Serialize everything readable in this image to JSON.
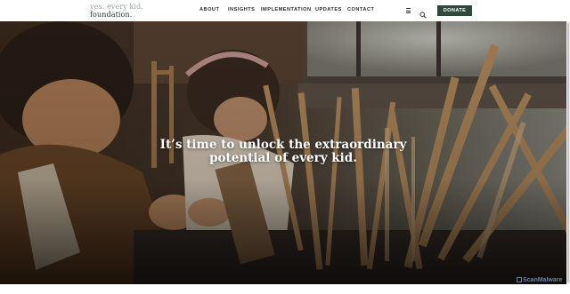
{
  "logo": {
    "line1": "yes. every kid.",
    "line2": "foundation."
  },
  "nav": {
    "items": [
      {
        "label": "ABOUT"
      },
      {
        "label": "INSIGHTS"
      },
      {
        "label": "IMPLEMENTATION"
      },
      {
        "label": "UPDATES"
      },
      {
        "label": "CONTACT"
      }
    ]
  },
  "header_icons": [
    "menu-icon",
    "search-icon"
  ],
  "donate": {
    "label": "DONATE"
  },
  "hero": {
    "headline_line1": "It’s time to unlock the extraordinary",
    "headline_line2": "potential of every kid."
  },
  "watermark": {
    "text": "ScanMalware"
  },
  "colors": {
    "donate_bg": "#2f4a3a",
    "nav_text": "#2b2b2b",
    "logo_muted": "#9aa0a3",
    "logo_dark": "#2e3a36"
  }
}
